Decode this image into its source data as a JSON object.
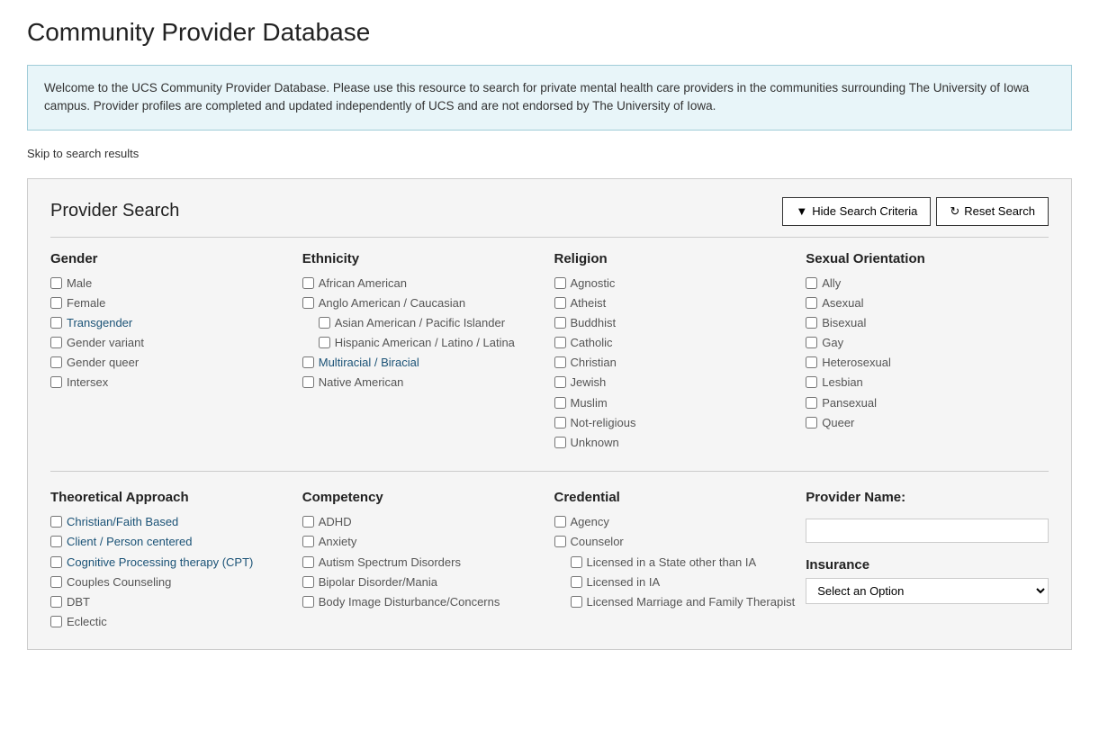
{
  "page": {
    "title": "Community Provider Database",
    "info_text": "Welcome to the UCS Community Provider Database. Please use this resource to search for private mental health care providers in the communities surrounding The University of Iowa campus. Provider profiles are completed and updated independently of UCS and are not endorsed by The University of Iowa.",
    "skip_link": "Skip to search results",
    "search_panel_title": "Provider Search",
    "hide_button": "Hide Search Criteria",
    "reset_button": "Reset Search"
  },
  "gender": {
    "title": "Gender",
    "items": [
      "Male",
      "Female",
      "Transgender",
      "Gender variant",
      "Gender queer",
      "Intersex"
    ]
  },
  "ethnicity": {
    "title": "Ethnicity",
    "items": [
      {
        "label": "African American",
        "indent": false
      },
      {
        "label": "Anglo American / Caucasian",
        "indent": false
      },
      {
        "label": "Asian American / Pacific Islander",
        "indent": true
      },
      {
        "label": "Hispanic American / Latino / Latina",
        "indent": true
      },
      {
        "label": "Multiracial / Biracial",
        "indent": false
      },
      {
        "label": "Native American",
        "indent": false
      }
    ]
  },
  "religion": {
    "title": "Religion",
    "items": [
      "Agnostic",
      "Atheist",
      "Buddhist",
      "Catholic",
      "Christian",
      "Jewish",
      "Muslim",
      "Not-religious",
      "Unknown"
    ]
  },
  "sexual_orientation": {
    "title": "Sexual Orientation",
    "items": [
      "Ally",
      "Asexual",
      "Bisexual",
      "Gay",
      "Heterosexual",
      "Lesbian",
      "Pansexual",
      "Queer"
    ]
  },
  "theoretical_approach": {
    "title": "Theoretical Approach",
    "items": [
      "Christian/Faith Based",
      "Client / Person centered",
      "Cognitive Processing therapy (CPT)",
      "Couples Counseling",
      "DBT",
      "Eclectic"
    ]
  },
  "competency": {
    "title": "Competency",
    "items": [
      "ADHD",
      "Anxiety",
      "Autism Spectrum Disorders",
      "Bipolar Disorder/Mania",
      "Body Image Disturbance/Concerns"
    ]
  },
  "credential": {
    "title": "Credential",
    "items": [
      {
        "label": "Agency",
        "indent": false
      },
      {
        "label": "Counselor",
        "indent": false
      },
      {
        "label": "Licensed in a State other than IA",
        "indent": true
      },
      {
        "label": "Licensed in IA",
        "indent": true
      },
      {
        "label": "Licensed Marriage and Family Therapist",
        "indent": true
      }
    ]
  },
  "provider_name": {
    "title": "Provider Name:",
    "placeholder": ""
  },
  "insurance": {
    "title": "Insurance",
    "placeholder": "Select an Option"
  }
}
